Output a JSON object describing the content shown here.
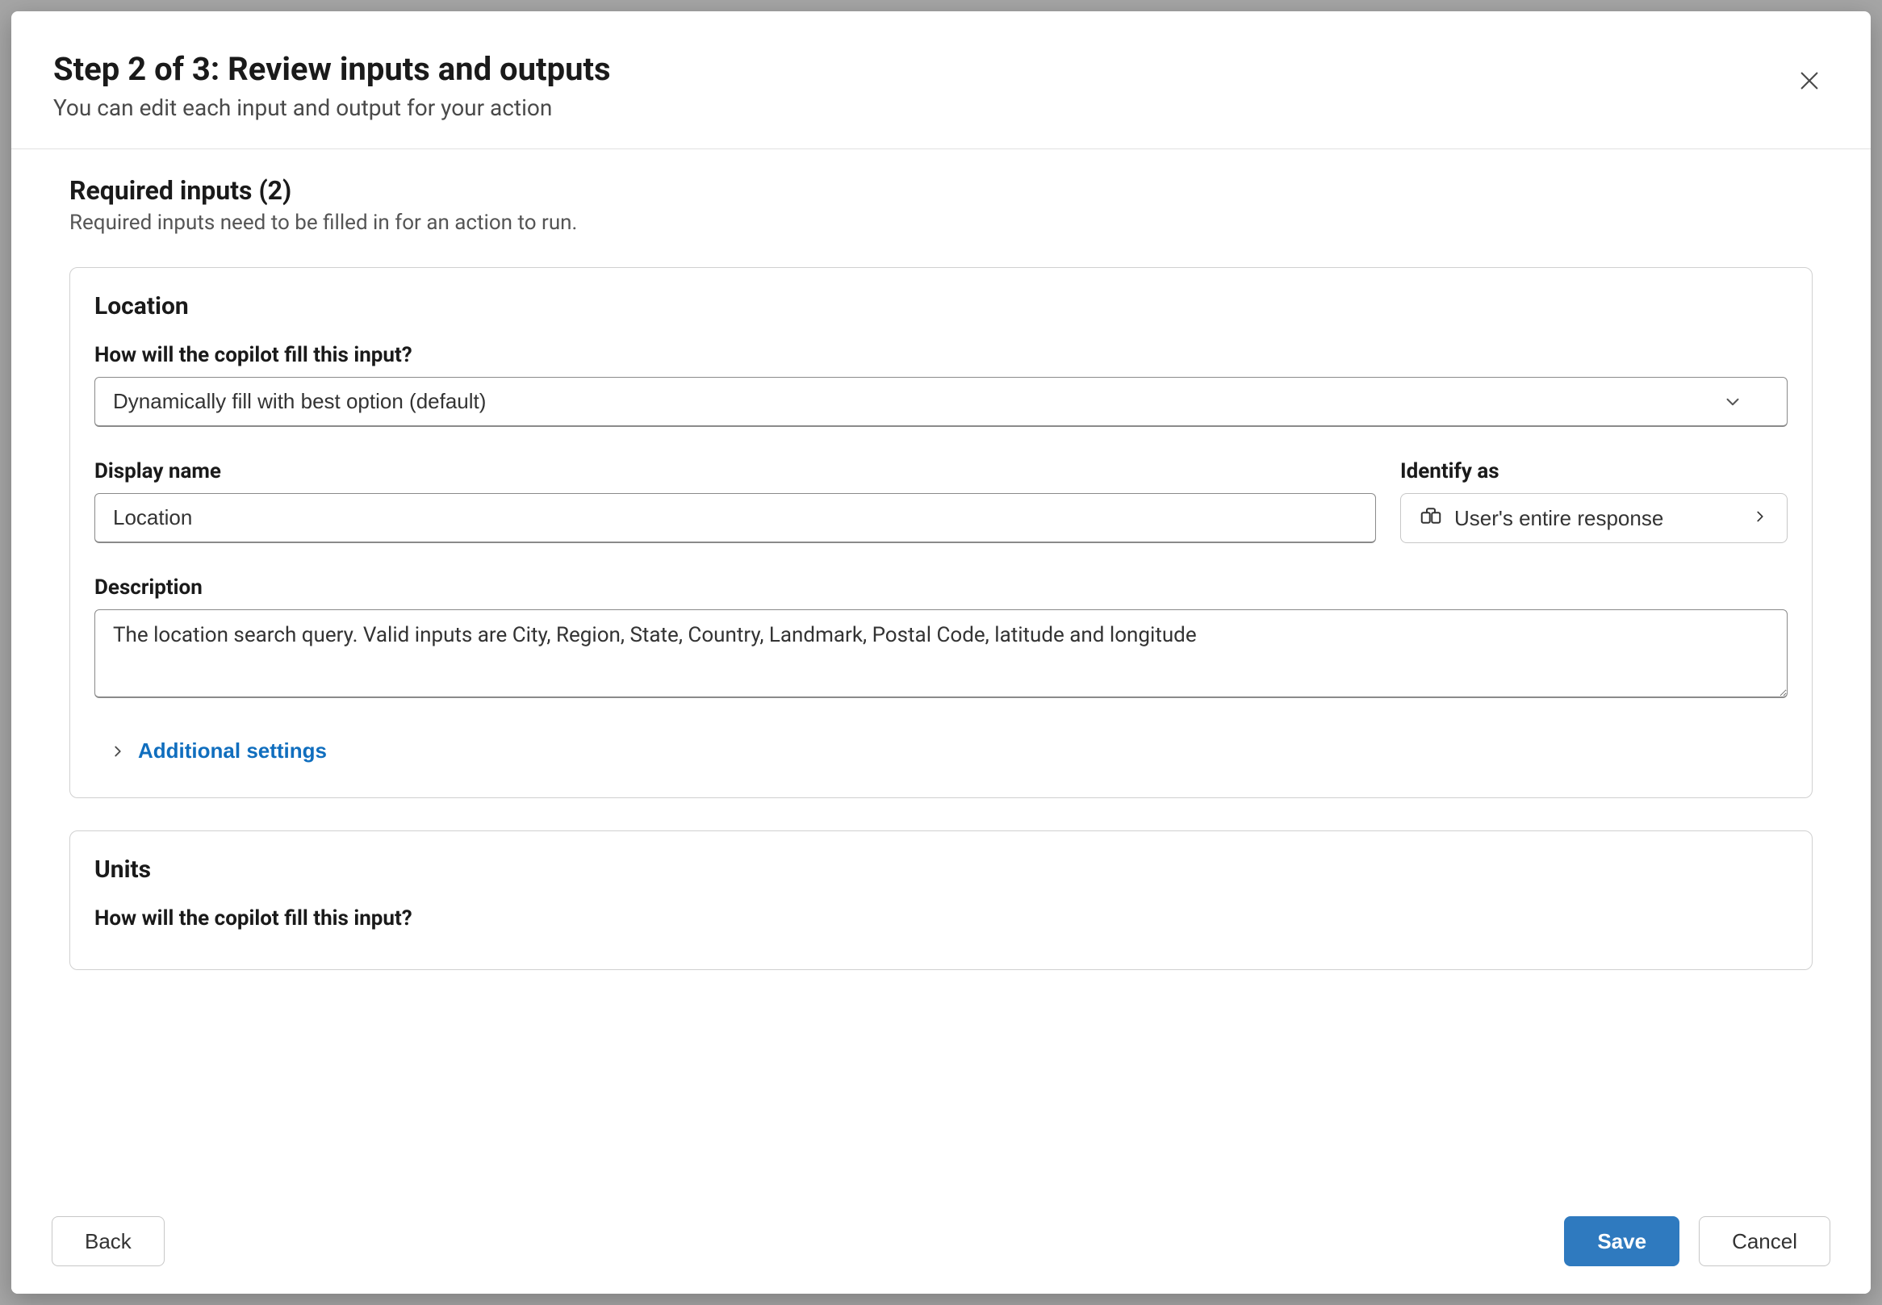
{
  "header": {
    "title": "Step 2 of 3: Review inputs and outputs",
    "subtitle": "You can edit each input and output for your action"
  },
  "section": {
    "heading": "Required inputs (2)",
    "subheading": "Required inputs need to be filled in for an action to run."
  },
  "cards": [
    {
      "title": "Location",
      "fill_label": "How will the copilot fill this input?",
      "fill_value": "Dynamically fill with best option (default)",
      "display_name_label": "Display name",
      "display_name_value": "Location",
      "identify_label": "Identify as",
      "identify_value": "User's entire response",
      "description_label": "Description",
      "description_value": "The location search query. Valid inputs are City, Region, State, Country, Landmark, Postal Code, latitude and longitude",
      "additional_label": "Additional settings"
    },
    {
      "title": "Units",
      "fill_label": "How will the copilot fill this input?"
    }
  ],
  "footer": {
    "back": "Back",
    "save": "Save",
    "cancel": "Cancel"
  }
}
